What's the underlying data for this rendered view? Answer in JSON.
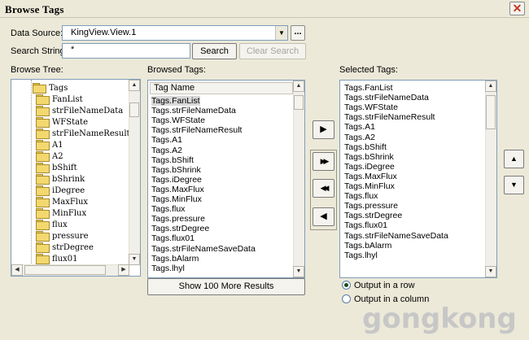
{
  "window": {
    "title": "Browse Tags",
    "close_glyph": "✕"
  },
  "labels": {
    "data_source": "Data Source:",
    "search_string": "Search String:",
    "browse_tree": "Browse Tree:",
    "browsed_tags": "Browsed Tags:",
    "selected_tags": "Selected Tags:"
  },
  "data_source": {
    "value": "KingView.View.1",
    "more_label": "..."
  },
  "search": {
    "value": "*",
    "search_button": "Search",
    "clear_button": "Clear Search"
  },
  "tree": {
    "items": [
      "Tags",
      "FanList",
      "strFileNameData",
      "WFState",
      "strFileNameResult",
      "A1",
      "A2",
      "bShift",
      "bShrink",
      "iDegree",
      "MaxFlux",
      "MinFlux",
      "flux",
      "pressure",
      "strDegree",
      "flux01"
    ]
  },
  "browsed": {
    "column_header": "Tag Name",
    "items": [
      "Tags.FanList",
      "Tags.strFileNameData",
      "Tags.WFState",
      "Tags.strFileNameResult",
      "Tags.A1",
      "Tags.A2",
      "Tags.bShift",
      "Tags.bShrink",
      "Tags.iDegree",
      "Tags.MaxFlux",
      "Tags.MinFlux",
      "Tags.flux",
      "Tags.pressure",
      "Tags.strDegree",
      "Tags.flux01",
      "Tags.strFileNameSaveData",
      "Tags.bAlarm",
      "Tags.lhyl"
    ],
    "selected_index": 0,
    "more_button": "Show 100 More Results"
  },
  "selected": {
    "items": [
      "Tags.FanList",
      "Tags.strFileNameData",
      "Tags.WFState",
      "Tags.strFileNameResult",
      "Tags.A1",
      "Tags.A2",
      "Tags.bShift",
      "Tags.bShrink",
      "Tags.iDegree",
      "Tags.MaxFlux",
      "Tags.MinFlux",
      "Tags.flux",
      "Tags.pressure",
      "Tags.strDegree",
      "Tags.flux01",
      "Tags.strFileNameSaveData",
      "Tags.bAlarm",
      "Tags.lhyl"
    ]
  },
  "transfer": {
    "add": "▶",
    "add_all": "▶▶",
    "remove_all": "◀◀",
    "remove": "◀"
  },
  "order": {
    "up": "▲",
    "down": "▼"
  },
  "output": {
    "row_label": "Output in a row",
    "column_label": "Output in a column",
    "selected": "row"
  },
  "watermark": {
    "text": "gongkong"
  }
}
